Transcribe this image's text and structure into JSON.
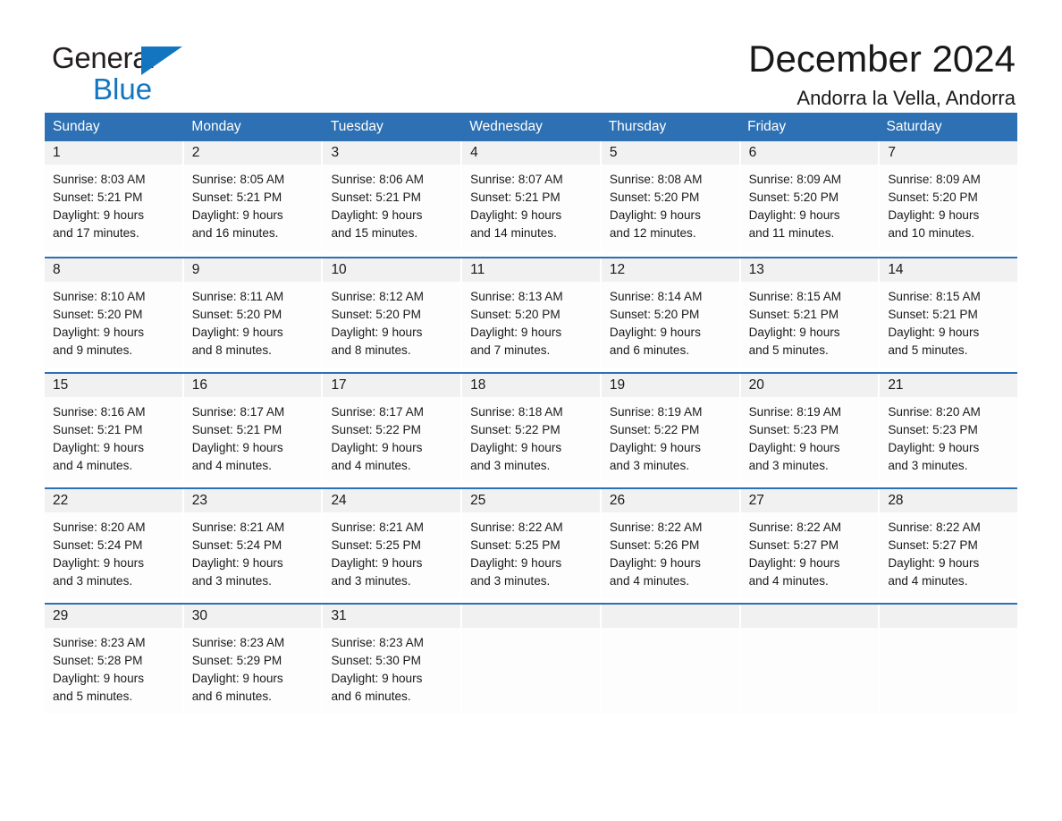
{
  "brand": {
    "name_part1": "General",
    "name_part2": "Blue"
  },
  "header": {
    "month_title": "December 2024",
    "location": "Andorra la Vella, Andorra"
  },
  "colors": {
    "header_blue": "#2d70b3",
    "brand_blue": "#1175c0",
    "day_band_gray": "#f1f1f1"
  },
  "calendar": {
    "weekdays": [
      "Sunday",
      "Monday",
      "Tuesday",
      "Wednesday",
      "Thursday",
      "Friday",
      "Saturday"
    ],
    "weeks": [
      [
        {
          "day": "1",
          "sunrise": "Sunrise: 8:03 AM",
          "sunset": "Sunset: 5:21 PM",
          "daylight_1": "Daylight: 9 hours",
          "daylight_2": "and 17 minutes."
        },
        {
          "day": "2",
          "sunrise": "Sunrise: 8:05 AM",
          "sunset": "Sunset: 5:21 PM",
          "daylight_1": "Daylight: 9 hours",
          "daylight_2": "and 16 minutes."
        },
        {
          "day": "3",
          "sunrise": "Sunrise: 8:06 AM",
          "sunset": "Sunset: 5:21 PM",
          "daylight_1": "Daylight: 9 hours",
          "daylight_2": "and 15 minutes."
        },
        {
          "day": "4",
          "sunrise": "Sunrise: 8:07 AM",
          "sunset": "Sunset: 5:21 PM",
          "daylight_1": "Daylight: 9 hours",
          "daylight_2": "and 14 minutes."
        },
        {
          "day": "5",
          "sunrise": "Sunrise: 8:08 AM",
          "sunset": "Sunset: 5:20 PM",
          "daylight_1": "Daylight: 9 hours",
          "daylight_2": "and 12 minutes."
        },
        {
          "day": "6",
          "sunrise": "Sunrise: 8:09 AM",
          "sunset": "Sunset: 5:20 PM",
          "daylight_1": "Daylight: 9 hours",
          "daylight_2": "and 11 minutes."
        },
        {
          "day": "7",
          "sunrise": "Sunrise: 8:09 AM",
          "sunset": "Sunset: 5:20 PM",
          "daylight_1": "Daylight: 9 hours",
          "daylight_2": "and 10 minutes."
        }
      ],
      [
        {
          "day": "8",
          "sunrise": "Sunrise: 8:10 AM",
          "sunset": "Sunset: 5:20 PM",
          "daylight_1": "Daylight: 9 hours",
          "daylight_2": "and 9 minutes."
        },
        {
          "day": "9",
          "sunrise": "Sunrise: 8:11 AM",
          "sunset": "Sunset: 5:20 PM",
          "daylight_1": "Daylight: 9 hours",
          "daylight_2": "and 8 minutes."
        },
        {
          "day": "10",
          "sunrise": "Sunrise: 8:12 AM",
          "sunset": "Sunset: 5:20 PM",
          "daylight_1": "Daylight: 9 hours",
          "daylight_2": "and 8 minutes."
        },
        {
          "day": "11",
          "sunrise": "Sunrise: 8:13 AM",
          "sunset": "Sunset: 5:20 PM",
          "daylight_1": "Daylight: 9 hours",
          "daylight_2": "and 7 minutes."
        },
        {
          "day": "12",
          "sunrise": "Sunrise: 8:14 AM",
          "sunset": "Sunset: 5:20 PM",
          "daylight_1": "Daylight: 9 hours",
          "daylight_2": "and 6 minutes."
        },
        {
          "day": "13",
          "sunrise": "Sunrise: 8:15 AM",
          "sunset": "Sunset: 5:21 PM",
          "daylight_1": "Daylight: 9 hours",
          "daylight_2": "and 5 minutes."
        },
        {
          "day": "14",
          "sunrise": "Sunrise: 8:15 AM",
          "sunset": "Sunset: 5:21 PM",
          "daylight_1": "Daylight: 9 hours",
          "daylight_2": "and 5 minutes."
        }
      ],
      [
        {
          "day": "15",
          "sunrise": "Sunrise: 8:16 AM",
          "sunset": "Sunset: 5:21 PM",
          "daylight_1": "Daylight: 9 hours",
          "daylight_2": "and 4 minutes."
        },
        {
          "day": "16",
          "sunrise": "Sunrise: 8:17 AM",
          "sunset": "Sunset: 5:21 PM",
          "daylight_1": "Daylight: 9 hours",
          "daylight_2": "and 4 minutes."
        },
        {
          "day": "17",
          "sunrise": "Sunrise: 8:17 AM",
          "sunset": "Sunset: 5:22 PM",
          "daylight_1": "Daylight: 9 hours",
          "daylight_2": "and 4 minutes."
        },
        {
          "day": "18",
          "sunrise": "Sunrise: 8:18 AM",
          "sunset": "Sunset: 5:22 PM",
          "daylight_1": "Daylight: 9 hours",
          "daylight_2": "and 3 minutes."
        },
        {
          "day": "19",
          "sunrise": "Sunrise: 8:19 AM",
          "sunset": "Sunset: 5:22 PM",
          "daylight_1": "Daylight: 9 hours",
          "daylight_2": "and 3 minutes."
        },
        {
          "day": "20",
          "sunrise": "Sunrise: 8:19 AM",
          "sunset": "Sunset: 5:23 PM",
          "daylight_1": "Daylight: 9 hours",
          "daylight_2": "and 3 minutes."
        },
        {
          "day": "21",
          "sunrise": "Sunrise: 8:20 AM",
          "sunset": "Sunset: 5:23 PM",
          "daylight_1": "Daylight: 9 hours",
          "daylight_2": "and 3 minutes."
        }
      ],
      [
        {
          "day": "22",
          "sunrise": "Sunrise: 8:20 AM",
          "sunset": "Sunset: 5:24 PM",
          "daylight_1": "Daylight: 9 hours",
          "daylight_2": "and 3 minutes."
        },
        {
          "day": "23",
          "sunrise": "Sunrise: 8:21 AM",
          "sunset": "Sunset: 5:24 PM",
          "daylight_1": "Daylight: 9 hours",
          "daylight_2": "and 3 minutes."
        },
        {
          "day": "24",
          "sunrise": "Sunrise: 8:21 AM",
          "sunset": "Sunset: 5:25 PM",
          "daylight_1": "Daylight: 9 hours",
          "daylight_2": "and 3 minutes."
        },
        {
          "day": "25",
          "sunrise": "Sunrise: 8:22 AM",
          "sunset": "Sunset: 5:25 PM",
          "daylight_1": "Daylight: 9 hours",
          "daylight_2": "and 3 minutes."
        },
        {
          "day": "26",
          "sunrise": "Sunrise: 8:22 AM",
          "sunset": "Sunset: 5:26 PM",
          "daylight_1": "Daylight: 9 hours",
          "daylight_2": "and 4 minutes."
        },
        {
          "day": "27",
          "sunrise": "Sunrise: 8:22 AM",
          "sunset": "Sunset: 5:27 PM",
          "daylight_1": "Daylight: 9 hours",
          "daylight_2": "and 4 minutes."
        },
        {
          "day": "28",
          "sunrise": "Sunrise: 8:22 AM",
          "sunset": "Sunset: 5:27 PM",
          "daylight_1": "Daylight: 9 hours",
          "daylight_2": "and 4 minutes."
        }
      ],
      [
        {
          "day": "29",
          "sunrise": "Sunrise: 8:23 AM",
          "sunset": "Sunset: 5:28 PM",
          "daylight_1": "Daylight: 9 hours",
          "daylight_2": "and 5 minutes."
        },
        {
          "day": "30",
          "sunrise": "Sunrise: 8:23 AM",
          "sunset": "Sunset: 5:29 PM",
          "daylight_1": "Daylight: 9 hours",
          "daylight_2": "and 6 minutes."
        },
        {
          "day": "31",
          "sunrise": "Sunrise: 8:23 AM",
          "sunset": "Sunset: 5:30 PM",
          "daylight_1": "Daylight: 9 hours",
          "daylight_2": "and 6 minutes."
        },
        {
          "day": "",
          "sunrise": "",
          "sunset": "",
          "daylight_1": "",
          "daylight_2": ""
        },
        {
          "day": "",
          "sunrise": "",
          "sunset": "",
          "daylight_1": "",
          "daylight_2": ""
        },
        {
          "day": "",
          "sunrise": "",
          "sunset": "",
          "daylight_1": "",
          "daylight_2": ""
        },
        {
          "day": "",
          "sunrise": "",
          "sunset": "",
          "daylight_1": "",
          "daylight_2": ""
        }
      ]
    ]
  }
}
